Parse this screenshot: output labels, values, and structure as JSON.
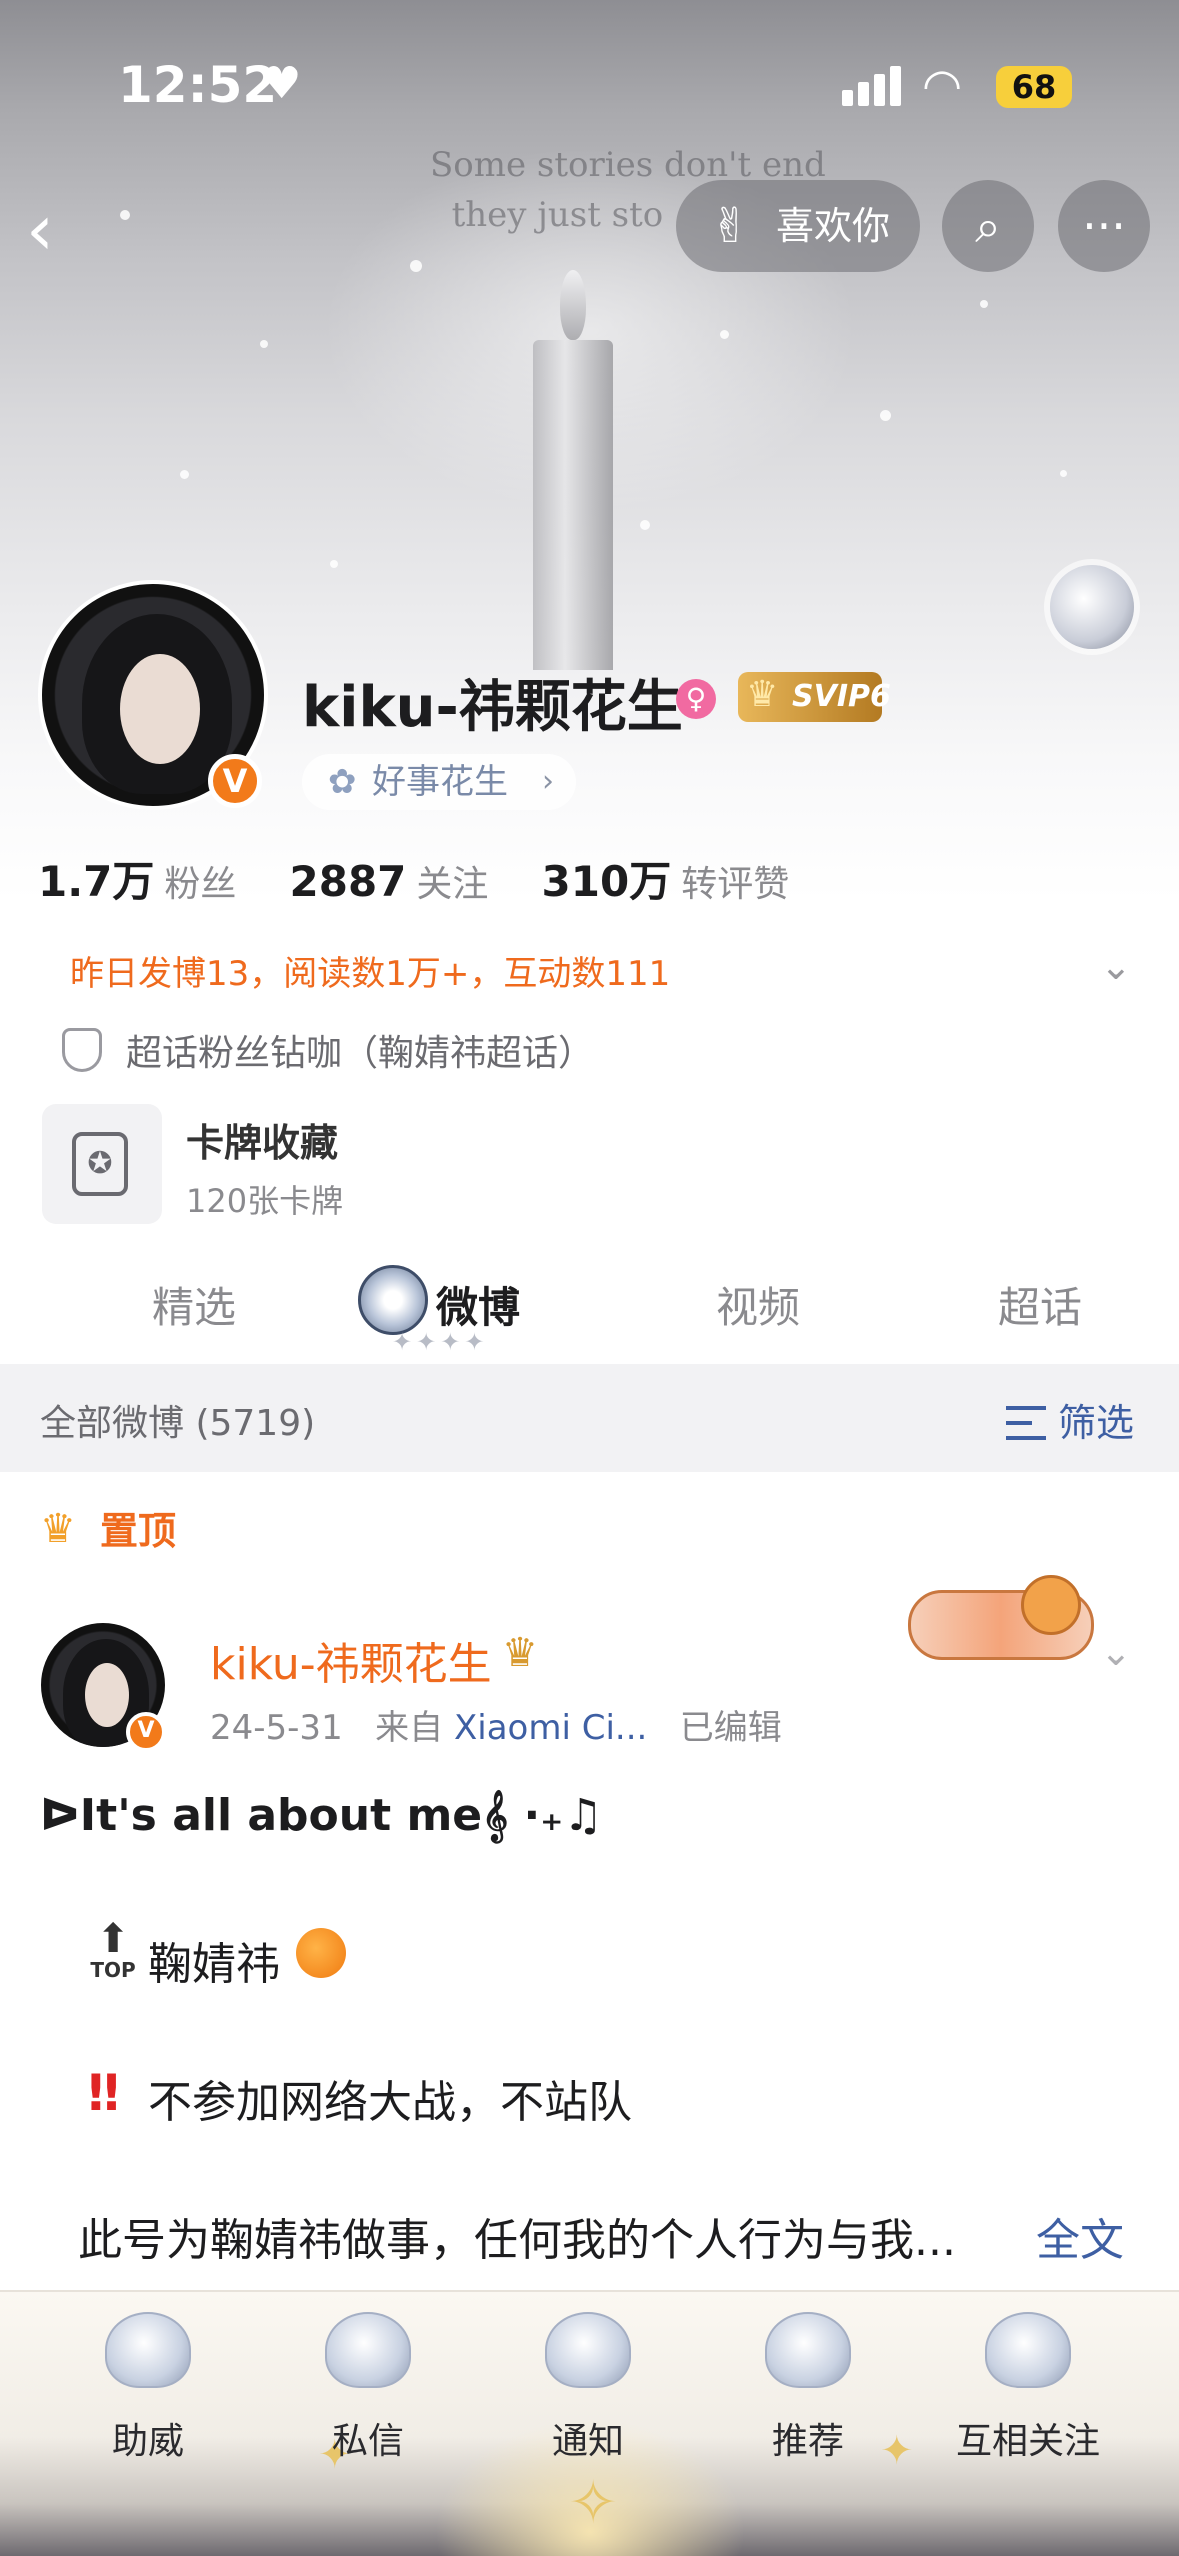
{
  "status_bar": {
    "time": "12:52",
    "battery": "68"
  },
  "banner": {
    "quote_line1": "Some stories don't end",
    "quote_line2": "they just sto"
  },
  "nav": {
    "like_label": "喜欢你"
  },
  "profile": {
    "username": "kiku-祎颗花生",
    "svip_label": "SVIP6",
    "tag_label": "好事花生",
    "verified_mark": "V",
    "stats": [
      {
        "num": "1.7万",
        "label": "粉丝"
      },
      {
        "num": "2887",
        "label": "关注"
      },
      {
        "num": "310万",
        "label": "转评赞"
      }
    ],
    "yesterday_summary": "昨日发博13，阅读数1万+，互动数111",
    "chaohua_badge": "超话粉丝钻咖（鞠婧祎超话）",
    "card_title": "卡牌收藏",
    "card_sub": "120张卡牌"
  },
  "tabs": [
    "精选",
    "微博",
    "视频",
    "超话"
  ],
  "active_tab": "微博",
  "filter_bar": {
    "all_posts": "全部微博 (5719)",
    "filter_label": "筛选"
  },
  "pinned_post": {
    "pinned_label": "置顶",
    "author": "kiku-祎颗花生",
    "date": "24-5-31",
    "from_label": "来自",
    "source": "Xiaomi Ci...",
    "edited": "已编辑",
    "line1": "ᐅIt's all about me𝄞 ·₊♫",
    "top_tag": "TOP",
    "line2": "鞠婧祎",
    "line3": "不参加网络大战，不站队",
    "line4": "此号为鞠婧祎做事，任何我的个人行为与我...",
    "full_text": "全文"
  },
  "bottom_bar": [
    {
      "label": "助威",
      "icon": "shell-icon"
    },
    {
      "label": "私信",
      "icon": "lily-icon"
    },
    {
      "label": "通知",
      "icon": "moon-icon"
    },
    {
      "label": "推荐",
      "icon": "coral-icon"
    },
    {
      "label": "互相关注",
      "icon": "heart-icon"
    }
  ],
  "colors": {
    "accent_orange": "#ef6a1d",
    "link_blue": "#3e5fa3",
    "battery_yellow": "#f7cf3b",
    "svip_gold": "#e8b75a"
  }
}
